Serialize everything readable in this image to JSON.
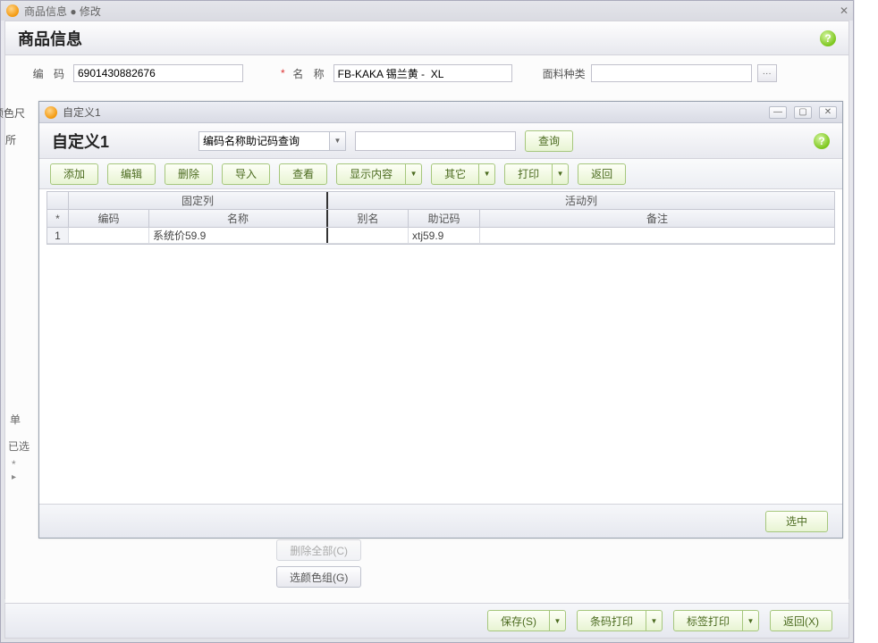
{
  "outer": {
    "title": "商品信息 ● 修改",
    "close": "✕"
  },
  "section": {
    "title": "商品信息"
  },
  "form": {
    "code_label": "编  码",
    "code_value": "6901430882676",
    "name_label": "名  称",
    "name_value": "FB-KAKA 锡兰黄 -  XL",
    "fabric_label": "面料种类",
    "fabric_value": "",
    "fabric_pick": "···",
    "color_label": "颜色尺",
    "f_label": "所",
    "tab_single": "单",
    "tab_selected": "已选",
    "row_marker": "*",
    "row_arrow": "▸"
  },
  "dialog": {
    "win_title": "自定义1",
    "header_title": "自定义1",
    "search_mode": "编码名称助记码查询",
    "search_value": "",
    "search_btn": "查询",
    "toolbar": {
      "add": "添加",
      "edit": "编辑",
      "delete": "删除",
      "import": "导入",
      "view": "查看",
      "display": "显示内容",
      "other": "其它",
      "print": "打印",
      "back": "返回"
    },
    "grid": {
      "group_fixed": "固定列",
      "group_active": "活动列",
      "star": "*",
      "h_code": "编码",
      "h_name": "名称",
      "h_alias": "别名",
      "h_mnemonic": "助记码",
      "h_remark": "备注",
      "rows": [
        {
          "idx": "1",
          "code": "",
          "name": "系统价59.9",
          "alias": "",
          "mnemonic": "xtj59.9",
          "remark": ""
        }
      ]
    },
    "footer": {
      "select": "选中"
    }
  },
  "peek": {
    "delete_all": "删除全部(C)",
    "color_group": "选颜色组(G)"
  },
  "footer": {
    "save": "保存(S)",
    "barcode": "条码打印",
    "label": "标签打印",
    "back": "返回(X)"
  }
}
